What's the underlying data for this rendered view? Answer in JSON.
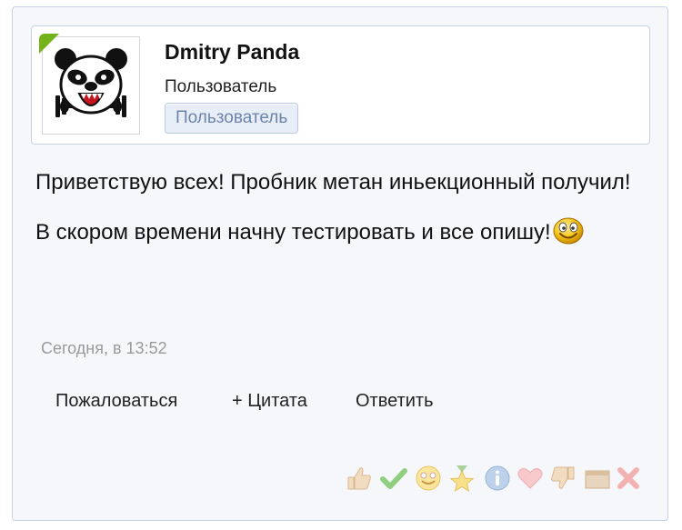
{
  "post": {
    "author": {
      "name": "Dmitry Panda",
      "title": "Пользователь",
      "role_badge": "Пользователь",
      "online": true
    },
    "message_text": "Приветствую всех! Пробник метан иньекционный получил! В скором времени начну тестировать и все опишу!",
    "message_emoji": "smile-emoji",
    "timestamp": "Сегодня, в 13:52",
    "actions": {
      "report": "Пожаловаться",
      "quote": "+ Цитата",
      "reply": "Ответить"
    },
    "reactions": [
      "thumbs-up-icon",
      "checkmark-icon",
      "smile-icon",
      "star-award-icon",
      "info-icon",
      "heart-icon",
      "thumbs-down-icon",
      "box-icon",
      "close-icon"
    ]
  },
  "colors": {
    "online": "#74b21a",
    "badge_text": "#6b84a8",
    "timestamp": "#9a9a9a"
  }
}
